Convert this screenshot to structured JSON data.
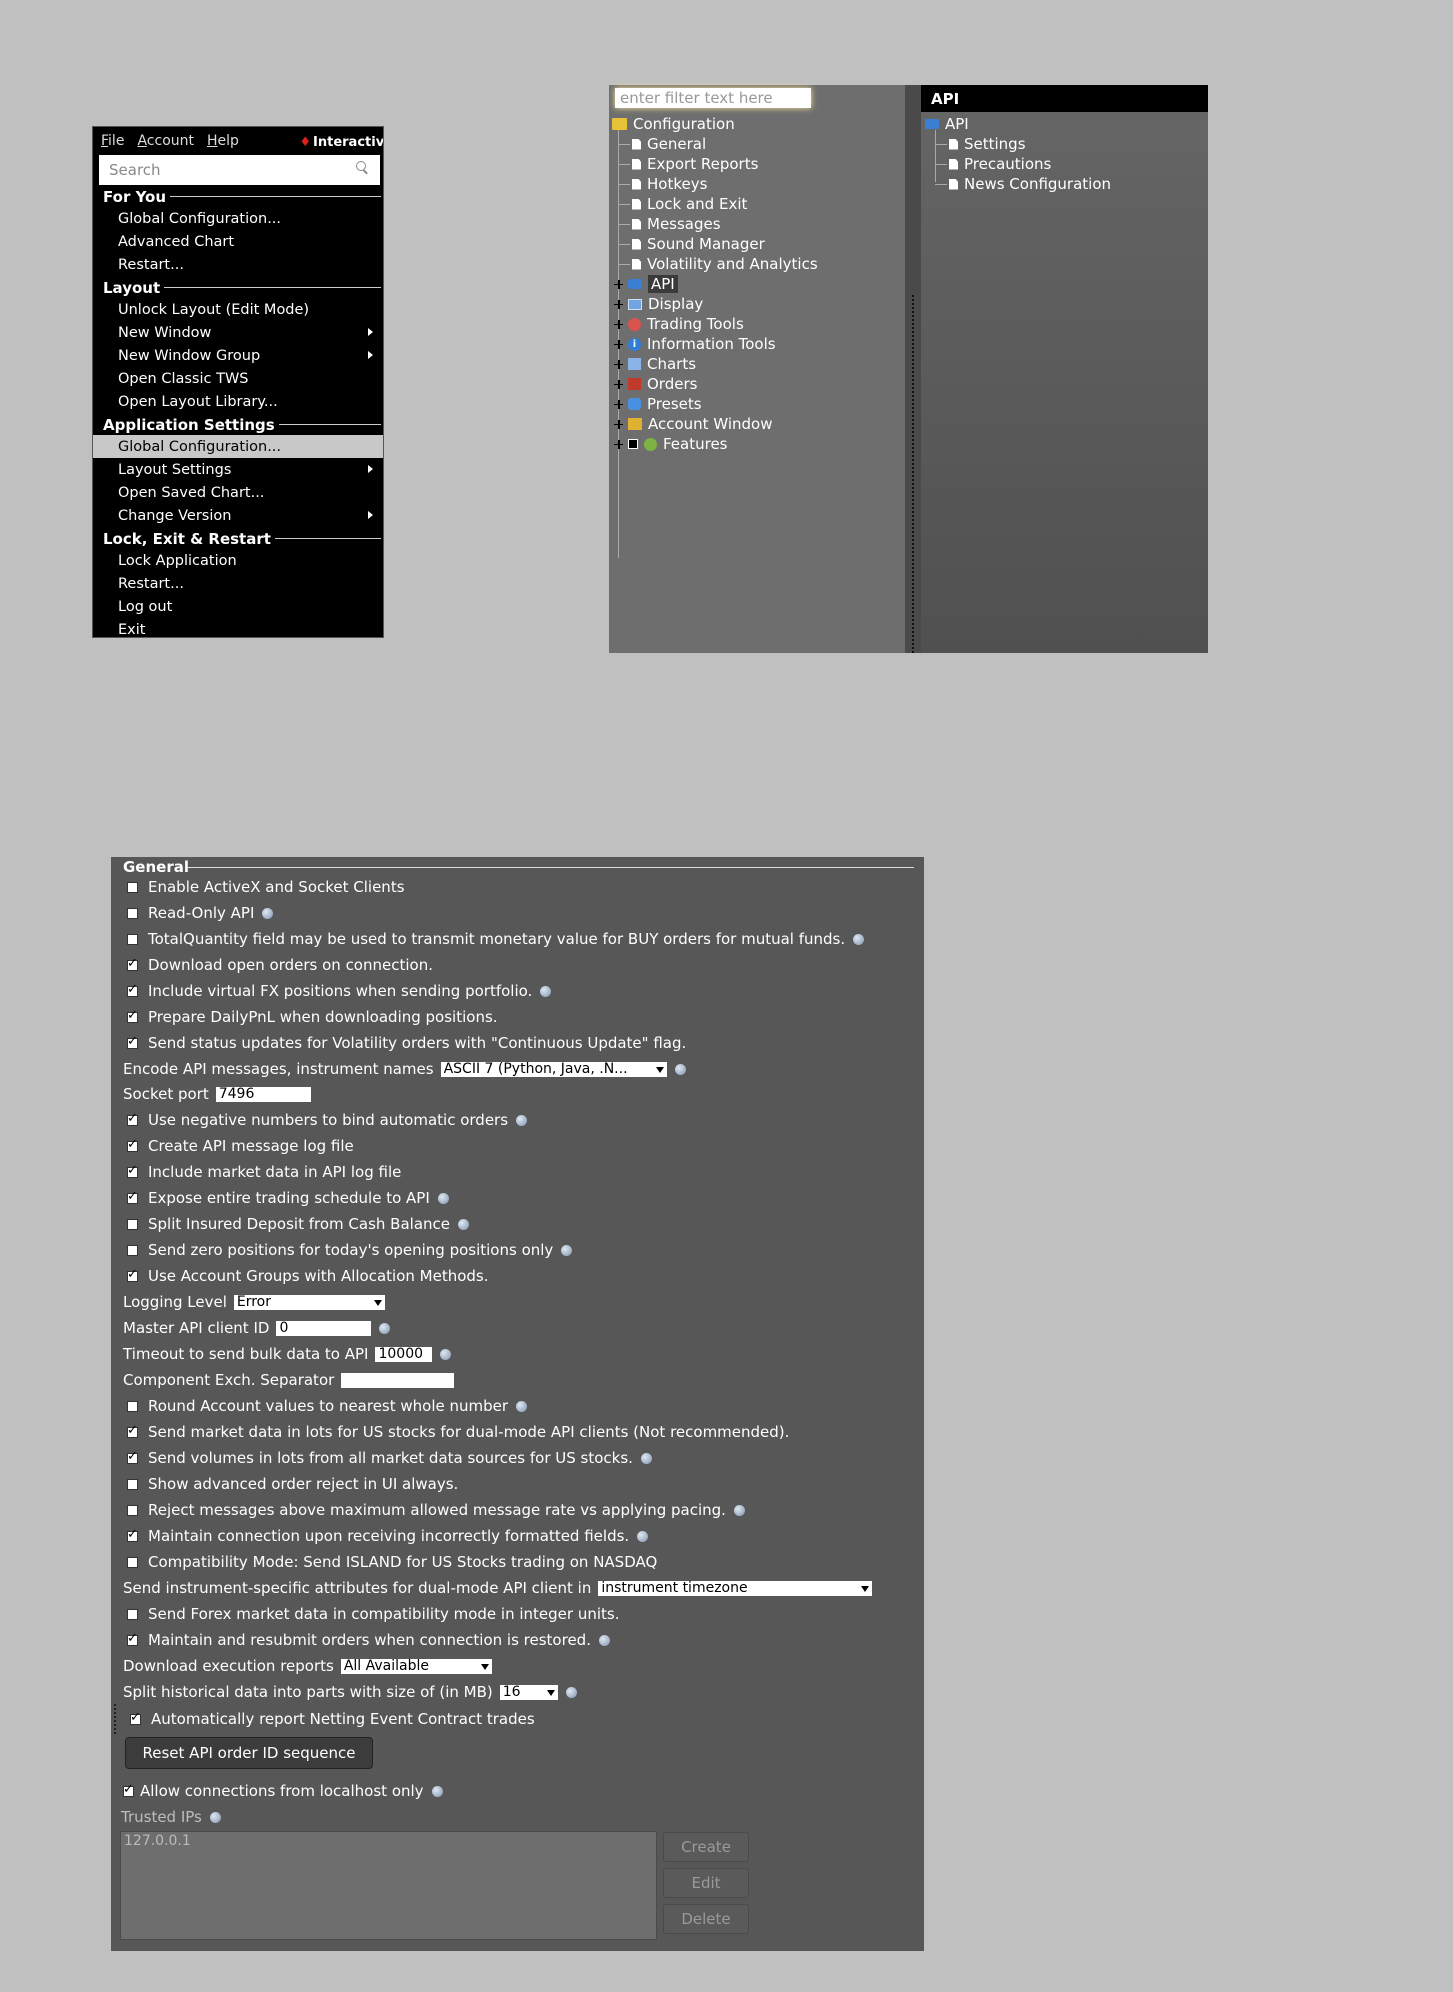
{
  "menu": {
    "bar": [
      "File",
      "Account",
      "Help"
    ],
    "logo": "Interactive",
    "search_placeholder": "Search",
    "sections": [
      {
        "title": "For You",
        "items": [
          {
            "label": "Global Configuration...",
            "submenu": false
          },
          {
            "label": "Advanced Chart",
            "submenu": false
          },
          {
            "label": "Restart...",
            "submenu": false
          }
        ]
      },
      {
        "title": "Layout",
        "items": [
          {
            "label": "Unlock Layout (Edit Mode)",
            "submenu": false
          },
          {
            "label": "New Window",
            "submenu": true
          },
          {
            "label": "New Window Group",
            "submenu": true
          },
          {
            "label": "Open Classic TWS",
            "submenu": false
          },
          {
            "label": "Open Layout Library...",
            "submenu": false
          }
        ]
      },
      {
        "title": "Application Settings",
        "items": [
          {
            "label": "Global Configuration...",
            "submenu": false,
            "highlighted": true
          },
          {
            "label": "Layout Settings",
            "submenu": true
          },
          {
            "label": "Open Saved Chart...",
            "submenu": false
          },
          {
            "label": "Change Version",
            "submenu": true
          }
        ]
      },
      {
        "title": "Lock, Exit & Restart",
        "items": [
          {
            "label": "Lock Application",
            "submenu": false
          },
          {
            "label": "Restart...",
            "submenu": false
          },
          {
            "label": "Log out",
            "submenu": false
          },
          {
            "label": "Exit",
            "submenu": false
          }
        ]
      }
    ]
  },
  "config": {
    "filter_placeholder": "enter filter text here",
    "root": "Configuration",
    "leaf_items": [
      "General",
      "Export Reports",
      "Hotkeys",
      "Lock and Exit",
      "Messages",
      "Sound Manager",
      "Volatility and Analytics"
    ],
    "groups": [
      {
        "label": "API",
        "icon": "api-icon",
        "selected": true
      },
      {
        "label": "Display",
        "icon": "display-icon"
      },
      {
        "label": "Trading Tools",
        "icon": "trading-tools-icon"
      },
      {
        "label": "Information Tools",
        "icon": "info-icon"
      },
      {
        "label": "Charts",
        "icon": "chart-icon"
      },
      {
        "label": "Orders",
        "icon": "orders-icon"
      },
      {
        "label": "Presets",
        "icon": "presets-icon"
      },
      {
        "label": "Account Window",
        "icon": "account-window-icon"
      },
      {
        "label": "Features",
        "icon": "features-icon"
      }
    ],
    "right_header": "API",
    "right_root": "API",
    "right_items": [
      "Settings",
      "Precautions",
      "News Configuration"
    ]
  },
  "general": {
    "title": "General",
    "rows": [
      {
        "type": "check",
        "label": "Enable ActiveX and Socket Clients",
        "checked": false,
        "help": false
      },
      {
        "type": "check",
        "label": "Read-Only API",
        "checked": false,
        "help": true
      },
      {
        "type": "check",
        "label": "TotalQuantity field may be used to transmit monetary value for BUY orders for mutual funds.",
        "checked": false,
        "help": true
      },
      {
        "type": "check",
        "label": "Download open orders on connection.",
        "checked": true,
        "help": false
      },
      {
        "type": "check",
        "label": "Include virtual FX positions when sending portfolio.",
        "checked": true,
        "help": true
      },
      {
        "type": "check",
        "label": "Prepare DailyPnL when downloading positions.",
        "checked": true,
        "help": false
      },
      {
        "type": "check",
        "label": "Send status updates for Volatility orders with \"Continuous Update\" flag.",
        "checked": true,
        "help": false
      },
      {
        "type": "field",
        "label": "Encode API messages, instrument names",
        "value": "ASCII 7 (Python, Java, .N...",
        "dropdown": true,
        "help": true
      },
      {
        "type": "field",
        "label": "Socket port",
        "value": "7496",
        "dropdown": false,
        "help": false
      },
      {
        "type": "check",
        "label": "Use negative numbers to bind automatic orders",
        "checked": true,
        "help": true
      },
      {
        "type": "check",
        "label": "Create API message log file",
        "checked": true,
        "help": false
      },
      {
        "type": "check",
        "label": "Include market data in API log file",
        "checked": true,
        "help": false
      },
      {
        "type": "check",
        "label": "Expose entire trading schedule to API",
        "checked": true,
        "help": true
      },
      {
        "type": "check",
        "label": "Split Insured Deposit from Cash Balance",
        "checked": false,
        "help": true
      },
      {
        "type": "check",
        "label": "Send zero positions for today's opening positions only",
        "checked": false,
        "help": true
      },
      {
        "type": "check",
        "label": "Use Account Groups with Allocation Methods.",
        "checked": true,
        "help": false
      },
      {
        "type": "field",
        "label": "Logging Level",
        "value": "Error",
        "dropdown": true,
        "help": false
      },
      {
        "type": "field",
        "label": "Master API client ID",
        "value": "0",
        "dropdown": false,
        "help": true
      },
      {
        "type": "field",
        "label": "Timeout to send bulk data to API",
        "value": "10000",
        "dropdown": false,
        "help": true
      },
      {
        "type": "field",
        "label": "Component Exch. Separator",
        "value": "",
        "dropdown": false,
        "help": false
      },
      {
        "type": "check",
        "label": "Round Account values to nearest whole number",
        "checked": false,
        "help": true
      },
      {
        "type": "check",
        "label": "Send market data in lots for US stocks for dual-mode API clients (Not recommended).",
        "checked": true,
        "help": false
      },
      {
        "type": "check",
        "label": "Send volumes in lots from all market data sources for US stocks.",
        "checked": true,
        "help": true
      },
      {
        "type": "check",
        "label": "Show advanced order reject in UI always.",
        "checked": false,
        "help": false
      },
      {
        "type": "check",
        "label": "Reject messages above maximum allowed message rate vs applying pacing.",
        "checked": false,
        "help": true
      },
      {
        "type": "check",
        "label": "Maintain connection upon receiving incorrectly formatted fields.",
        "checked": true,
        "help": true
      },
      {
        "type": "check",
        "label": "Compatibility Mode: Send ISLAND for US Stocks trading on NASDAQ",
        "checked": false,
        "help": false
      },
      {
        "type": "field",
        "label": "Send instrument-specific attributes for dual-mode API client in",
        "value": "instrument timezone",
        "dropdown": true,
        "help": false
      },
      {
        "type": "check",
        "label": "Send Forex market data in compatibility mode in integer units.",
        "checked": false,
        "help": false
      },
      {
        "type": "check",
        "label": "Maintain and resubmit orders when connection is restored.",
        "checked": true,
        "help": true
      },
      {
        "type": "field",
        "label": "Download execution reports",
        "value": "All Available",
        "dropdown": true,
        "help": false
      },
      {
        "type": "field",
        "label": "Split historical data into parts with size of (in MB)",
        "value": "16",
        "dropdown": true,
        "help": true
      },
      {
        "type": "check",
        "label": "Automatically report Netting Event Contract trades",
        "checked": true,
        "help": false
      }
    ],
    "reset_button": "Reset API order ID sequence",
    "localhost_label": "Allow connections from localhost only",
    "localhost_checked": true,
    "trusted_label": "Trusted IPs",
    "trusted_ips": [
      "127.0.0.1"
    ],
    "buttons": [
      "Create",
      "Edit",
      "Delete"
    ]
  }
}
